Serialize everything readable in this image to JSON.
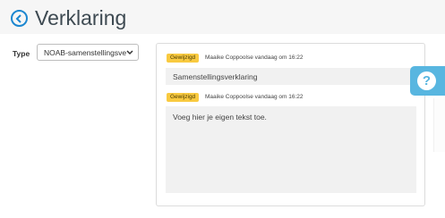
{
  "header": {
    "title": "Verklaring"
  },
  "form": {
    "type_label": "Type",
    "type_value": "NOAB-samenstellingsverklaring"
  },
  "entries": [
    {
      "badge": "Gewijzigd",
      "meta": "Maaike Coppoolse vandaag om 16:22",
      "text": "Samenstellingsverklaring"
    },
    {
      "badge": "Gewijzigd",
      "meta": "Maaike Coppoolse vandaag om 16:22",
      "text": "Voeg hier je eigen tekst toe."
    }
  ],
  "help": {
    "symbol": "?"
  },
  "colors": {
    "accent": "#1c87d0",
    "badge": "#f9ca40",
    "help": "#58b6e0"
  }
}
